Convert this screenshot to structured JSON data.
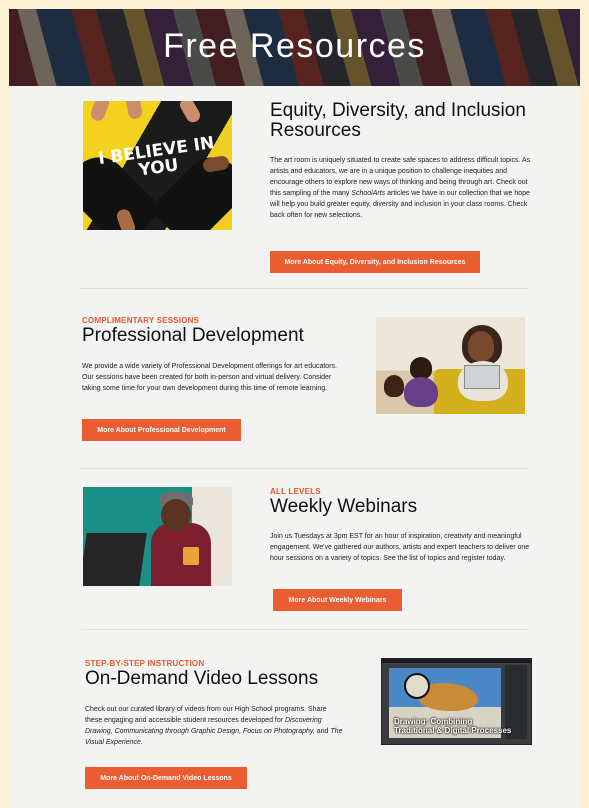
{
  "hero": {
    "title": "Free Resources"
  },
  "sections": {
    "edi": {
      "title": "Equity, Diversity, and Inclusion Resources",
      "image_text": "I BELIEVE IN YOU",
      "body_part1": "The art room is uniquely situated to create safe spaces to address difficult topics. As artists and educators, we are in a unique position to challenge inequities and encourage others to explore new ways of thinking and being through art. Check out this sampling of the many ",
      "body_emphasis": "SchoolArts",
      "body_part2": " articles we have in our collection that we hope will help you build greater equity, diversity and inclusion in your class rooms. Check back often for new selections.",
      "button": "More About Equity, Diversity, and Inclusion Resources"
    },
    "pd": {
      "eyebrow": "COMPLIMENTARY SESSIONS",
      "title": "Professional Development",
      "body": "We provide a wide variety of Professional Development offerings for art educators. Our sessions have been created for both in-person and virtual delivery. Consider taking some time for your own development during this time of remote learning.",
      "button": "More About Professional Development"
    },
    "webinars": {
      "eyebrow": "ALL LEVELS",
      "title": "Weekly Webinars",
      "body": "Join us Tuesdays at 3pm EST for an hour of inspiration, creativity and meaningful engagement.  We've gathered our authors, artists and expert teachers to deliver one hour sessions on a variety of topics.  See the list of topics and register today.",
      "button": "More About Weekly Webinars"
    },
    "video": {
      "eyebrow": "STEP-BY-STEP INSTRUCTION",
      "title": "On-Demand Video Lessons",
      "body_part1": "Check out our curated library of videos from our High School programs. Share these engaging and accessible student resources developed for ",
      "body_emphasis": "Discovering Drawing, Communicating through Graphic Design, Focus on Photography,",
      "body_part2": " and ",
      "body_emphasis2": "The Visual Experience.",
      "thumb_caption_line1": "Drawing: Combining",
      "thumb_caption_line2": "Traditional & Digital Processes",
      "button": "More About On-Demand Video Lessons"
    }
  },
  "colors": {
    "accent": "#ea5c32",
    "eyebrow": "#e0582f",
    "page_bg": "#f3f3f2",
    "frame": "#fbf1d6"
  }
}
